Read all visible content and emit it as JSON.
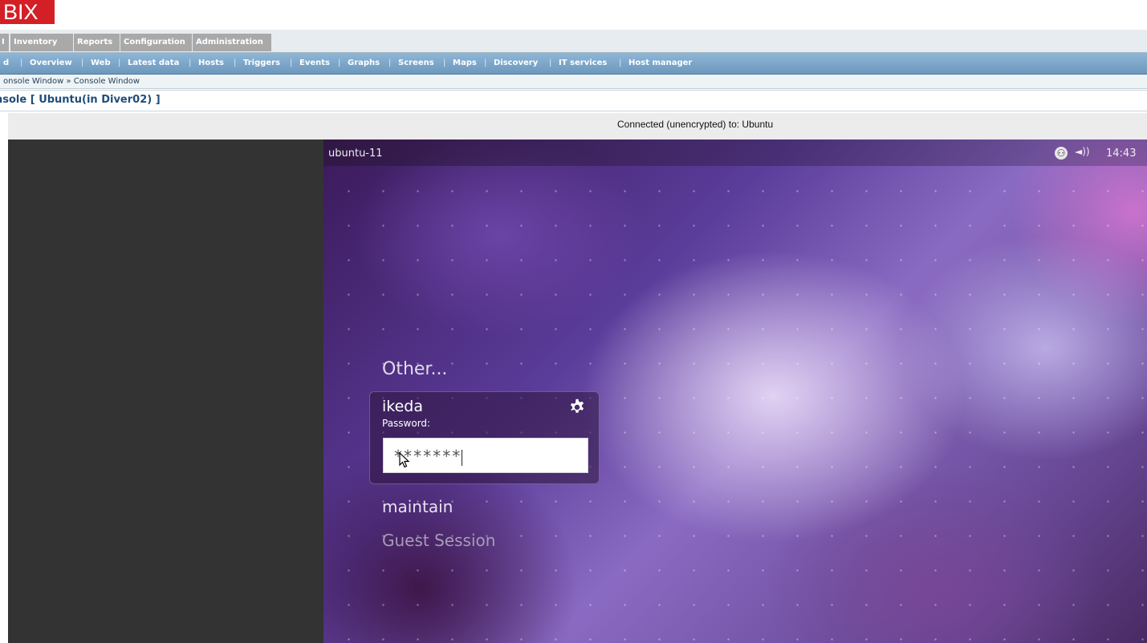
{
  "brand": {
    "logo_text": "BIX",
    "color": "#d31f26"
  },
  "main_menu": [
    {
      "label": "I"
    },
    {
      "label": "Inventory"
    },
    {
      "label": "Reports"
    },
    {
      "label": "Configuration"
    },
    {
      "label": "Administration"
    }
  ],
  "sub_menu": [
    {
      "label": "d"
    },
    {
      "label": "Overview"
    },
    {
      "label": "Web"
    },
    {
      "label": "Latest data"
    },
    {
      "label": "Hosts"
    },
    {
      "label": "Triggers"
    },
    {
      "label": "Events"
    },
    {
      "label": "Graphs"
    },
    {
      "label": "Screens"
    },
    {
      "label": "Maps"
    },
    {
      "label": "Discovery"
    },
    {
      "label": "IT services"
    },
    {
      "label": "Host manager"
    }
  ],
  "breadcrumb": {
    "text": "onsole Window » Console Window"
  },
  "page_title": "nsole [ Ubuntu(in Diver02) ]",
  "vnc_status": "Connected (unencrypted) to: Ubuntu",
  "remote": {
    "hostname": "ubuntu-11",
    "clock": "14:43",
    "indicators": {
      "accessibility": "accessibility-icon",
      "volume": "volume-icon"
    },
    "users": {
      "other": "Other...",
      "selected": "ikeda",
      "password_label": "Password:",
      "password_value": "*******",
      "maintain": "maintain",
      "guest": "Guest Session"
    }
  }
}
